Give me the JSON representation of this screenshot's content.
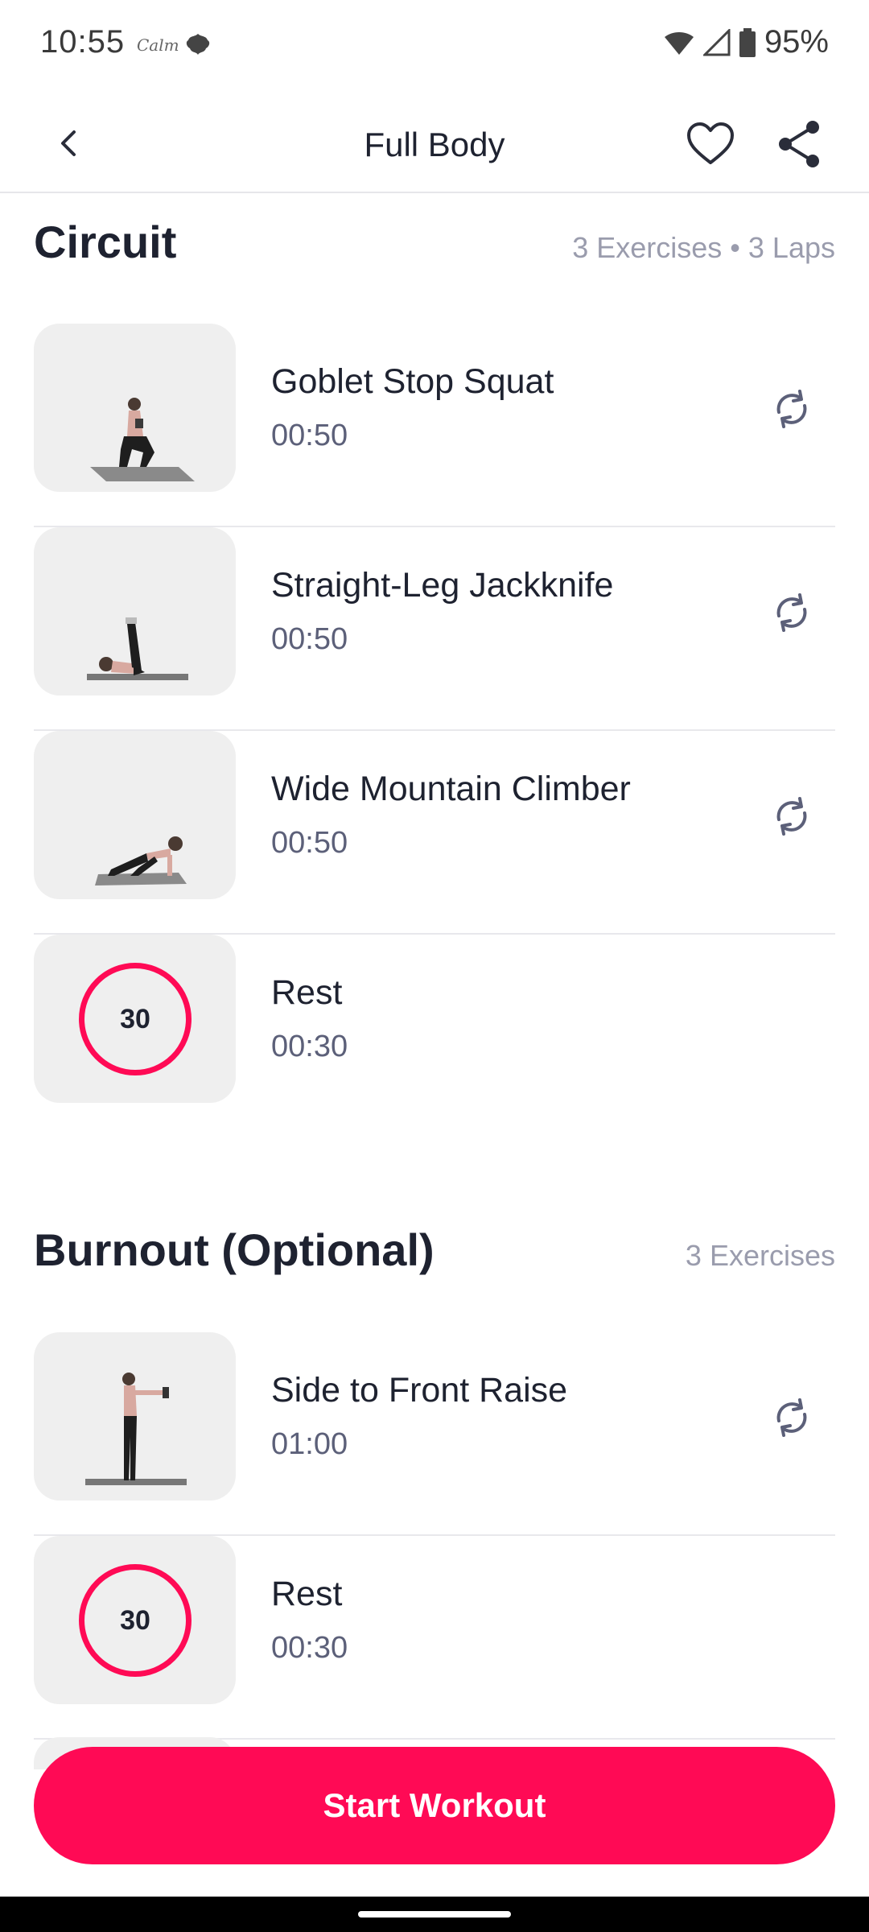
{
  "status_bar": {
    "time": "10:55",
    "app_label": "Calm",
    "battery": "95%",
    "icons": [
      "wifi-icon",
      "cell-signal-icon",
      "battery-icon"
    ]
  },
  "header": {
    "title": "Full Body",
    "back_icon": "chevron-left-icon",
    "favorite_icon": "heart-icon",
    "share_icon": "share-icon"
  },
  "sections": [
    {
      "title": "Circuit",
      "meta": "3 Exercises • 3 Laps",
      "items": [
        {
          "name": "Goblet Stop Squat",
          "time": "00:50",
          "type": "exercise"
        },
        {
          "name": "Straight-Leg Jackknife",
          "time": "00:50",
          "type": "exercise"
        },
        {
          "name": "Wide Mountain Climber",
          "time": "00:50",
          "type": "exercise"
        },
        {
          "name": "Rest",
          "time": "00:30",
          "type": "rest",
          "badge": "30"
        }
      ]
    },
    {
      "title": "Burnout (Optional)",
      "meta": "3 Exercises",
      "items": [
        {
          "name": "Side to Front Raise",
          "time": "01:00",
          "type": "exercise"
        },
        {
          "name": "Rest",
          "time": "00:30",
          "type": "rest",
          "badge": "30"
        }
      ]
    }
  ],
  "cta": {
    "label": "Start Workout"
  },
  "colors": {
    "accent": "#ff0a55",
    "text": "#1e2230",
    "muted": "#9a9cad",
    "tile": "#efefef"
  }
}
